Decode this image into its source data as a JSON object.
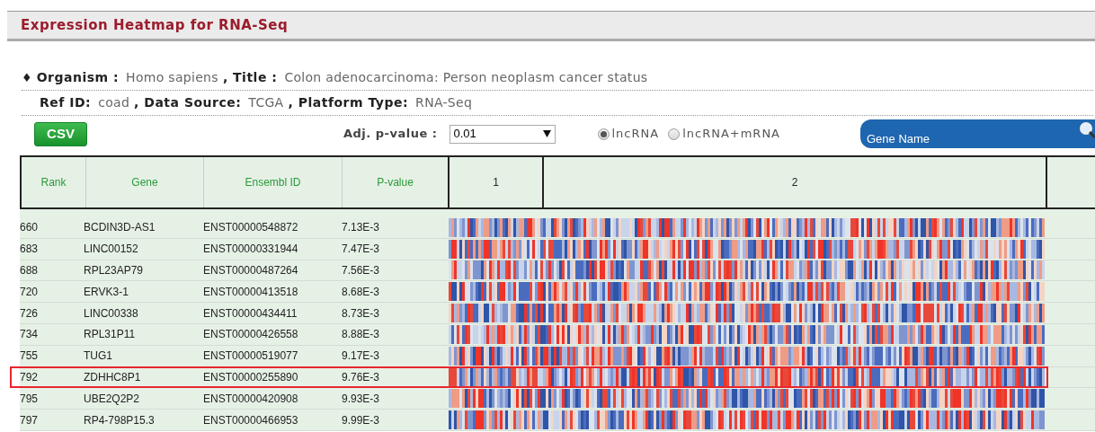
{
  "header": {
    "title": "Expression Heatmap for RNA-Seq"
  },
  "info_lines": [
    {
      "bullet": "♦",
      "fields": [
        {
          "label": "Organism :",
          "value": "Homo sapiens"
        },
        {
          "label": ", Title :",
          "value": "Colon adenocarcinoma: Person neoplasm cancer status"
        }
      ]
    },
    {
      "fields": [
        {
          "label": "Ref ID:",
          "value": "coad"
        },
        {
          "label": ", Data Source:",
          "value": "TCGA"
        },
        {
          "label": ", Platform Type:",
          "value": "RNA-Seq"
        }
      ]
    }
  ],
  "toolbar": {
    "csv_button": "CSV",
    "pvalue": {
      "label": "Adj. p-value :",
      "value": "0.01"
    },
    "radios": [
      {
        "label": "lncRNA",
        "selected": true
      },
      {
        "label": "lncRNA+mRNA",
        "selected": false
      }
    ],
    "search": {
      "placeholder": "Gene Name"
    }
  },
  "table": {
    "columns": [
      "Rank",
      "Gene",
      "Ensembl ID",
      "P-value",
      "1",
      "2"
    ],
    "rows": [
      {
        "rank": "660",
        "gene": "BCDIN3D-AS1",
        "ensembl_id": "ENST00000548872",
        "p_value": "7.13E-3",
        "highlighted": false
      },
      {
        "rank": "683",
        "gene": "LINC00152",
        "ensembl_id": "ENST00000331944",
        "p_value": "7.47E-3",
        "highlighted": false
      },
      {
        "rank": "688",
        "gene": "RPL23AP79",
        "ensembl_id": "ENST00000487264",
        "p_value": "7.56E-3",
        "highlighted": false
      },
      {
        "rank": "720",
        "gene": "ERVK3-1",
        "ensembl_id": "ENST00000413518",
        "p_value": "8.68E-3",
        "highlighted": false
      },
      {
        "rank": "726",
        "gene": "LINC00338",
        "ensembl_id": "ENST00000434411",
        "p_value": "8.73E-3",
        "highlighted": false
      },
      {
        "rank": "734",
        "gene": "RPL31P11",
        "ensembl_id": "ENST00000426558",
        "p_value": "8.88E-3",
        "highlighted": false
      },
      {
        "rank": "755",
        "gene": "TUG1",
        "ensembl_id": "ENST00000519077",
        "p_value": "9.17E-3",
        "highlighted": false
      },
      {
        "rank": "792",
        "gene": "ZDHHC8P1",
        "ensembl_id": "ENST00000255890",
        "p_value": "9.76E-3",
        "highlighted": true
      },
      {
        "rank": "795",
        "gene": "UBE2Q2P2",
        "ensembl_id": "ENST00000420908",
        "p_value": "9.93E-3",
        "highlighted": false
      },
      {
        "rank": "797",
        "gene": "RP4-798P15.3",
        "ensembl_id": "ENST00000466953",
        "p_value": "9.99E-3",
        "highlighted": false
      }
    ]
  }
}
